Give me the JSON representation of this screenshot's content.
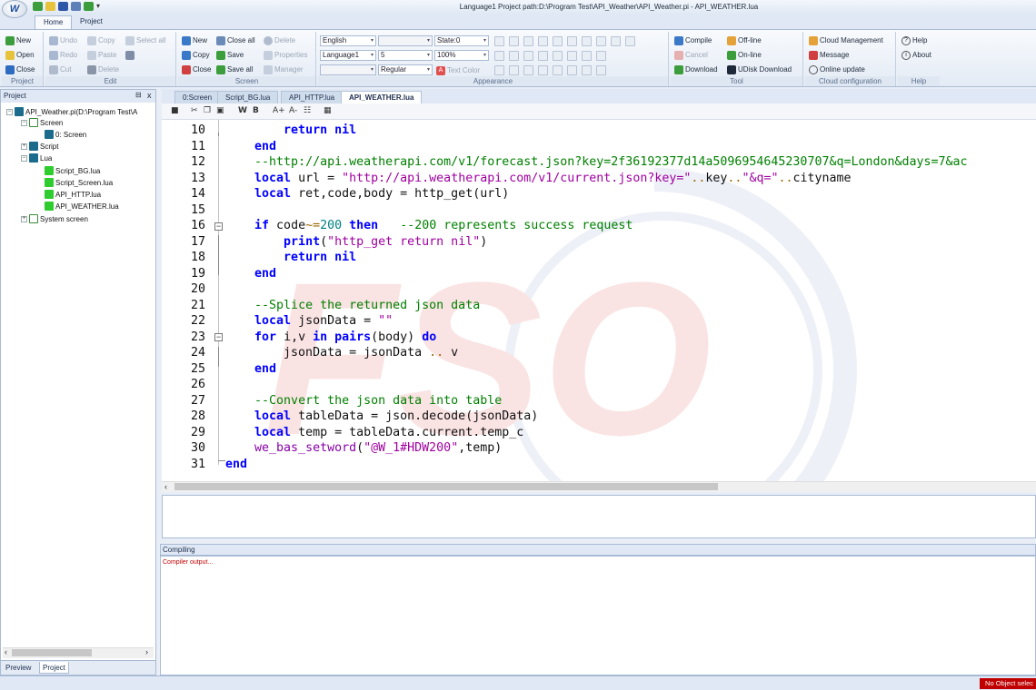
{
  "app": {
    "title": "Language1   Project path:D:\\Program Test\\API_Weather\\API_Weather.pi  - API_WEATHER.lua"
  },
  "ribbon_tabs": [
    "Home",
    "Project"
  ],
  "ribbon": {
    "project_group": {
      "label": "Project",
      "new": "New",
      "open": "Open",
      "close": "Close"
    },
    "edit_group": {
      "label": "Edit",
      "undo": "Undo",
      "copy": "Copy",
      "select_all": "Select all",
      "redo": "Redo",
      "paste": "Paste",
      "cut": "Cut",
      "delete": "Delete"
    },
    "screen_group": {
      "label": "Screen",
      "new": "New",
      "close_all": "Close all",
      "delete": "Delete",
      "copy": "Copy",
      "save": "Save",
      "properties": "Properties",
      "close": "Close",
      "save_all": "Save all",
      "manager": "Manager"
    },
    "appearance_group": {
      "label": "Appearance",
      "language": "English",
      "language_dup": "Language1",
      "state": "State:0",
      "zoom": "100%",
      "font_size": "5",
      "font_style": "Regular",
      "text_color": "Text Color"
    },
    "tool_group": {
      "label": "Tool",
      "compile": "Compile",
      "offline": "Off-line",
      "cancel": "Cancel",
      "online": "On-line",
      "download": "Download",
      "udisk": "UDisk Download"
    },
    "cloud_group": {
      "label": "Cloud configuration",
      "cloud_mgmt": "Cloud Management",
      "message": "Message",
      "online_update": "Online update"
    },
    "help_group": {
      "label": "Help",
      "help": "Help",
      "about": "About"
    }
  },
  "left_panel": {
    "title": "Project",
    "close": "x",
    "pin": "⊟",
    "tree": {
      "root": "API_Weather.pi(D:\\Program Test\\A",
      "screen": "Screen",
      "screen0": "0: Screen",
      "script": "Script",
      "lua": "Lua",
      "lua_files": [
        "Script_BG.lua",
        "Script_Screen.lua",
        "API_HTTP.lua",
        "API_WEATHER.lua"
      ],
      "system_screen": "System screen"
    },
    "bottom_tabs": [
      "Preview",
      "Project"
    ]
  },
  "doc_tabs": [
    "0:Screen",
    "Script_BG.lua",
    "API_HTTP.lua",
    "API_WEATHER.lua"
  ],
  "editor": {
    "line_numbers": [
      "10",
      "11",
      "12",
      "13",
      "14",
      "15",
      "16",
      "17",
      "18",
      "19",
      "20",
      "21",
      "22",
      "23",
      "24",
      "25",
      "26",
      "27",
      "28",
      "29",
      "30",
      "31"
    ]
  },
  "compiling": {
    "title": "Compiling",
    "output": "Compiler output..."
  },
  "status": {
    "no_object": "No Object selec"
  },
  "colors": {
    "accent": "#1b4c9c",
    "keyword": "#0000ff",
    "comment": "#008000",
    "string": "#a000a0",
    "status_red": "#c00000"
  }
}
